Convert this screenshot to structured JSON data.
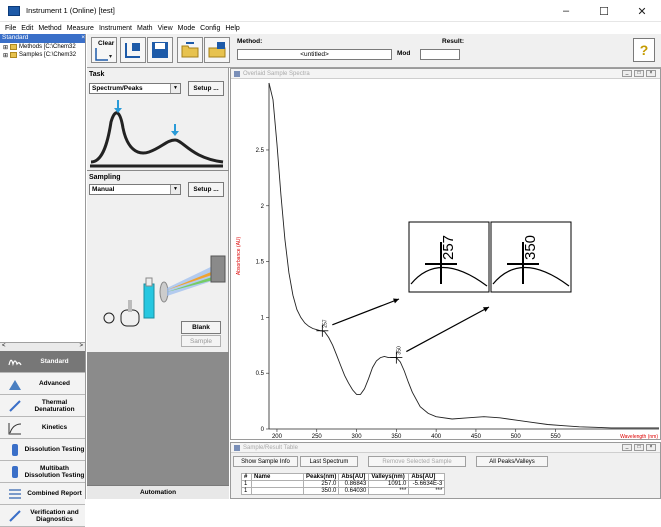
{
  "window": {
    "title": "Instrument 1 (Online) [test]",
    "controls": [
      "–",
      "☐",
      "✕"
    ]
  },
  "menu": [
    "File",
    "Edit",
    "Method",
    "Measure",
    "Instrument",
    "Math",
    "View",
    "Mode",
    "Config",
    "Help"
  ],
  "tree": {
    "header": "Standard",
    "items": [
      "Methods [C:\\Chem32",
      "Samples [C:\\Chem32"
    ]
  },
  "scroll": {
    "left": "<",
    "right": ">"
  },
  "nav": [
    {
      "label": "Standard",
      "icon": "standard-icon",
      "active": true
    },
    {
      "label": "Advanced",
      "icon": "advanced-icon"
    },
    {
      "label": "Thermal Denaturation",
      "icon": "thermal-icon"
    },
    {
      "label": "Kinetics",
      "icon": "kinetics-icon"
    },
    {
      "label": "Dissolution Testing",
      "icon": "dissolution-icon"
    },
    {
      "label": "Multibath Dissolution Testing",
      "icon": "multibath-icon"
    },
    {
      "label": "Combined Report",
      "icon": "report-icon"
    },
    {
      "label": "Verification and Diagnostics",
      "icon": "verification-icon"
    }
  ],
  "toolbar": {
    "clear_label": "Clear",
    "method_label": "Method:",
    "method_value": "<untitled>",
    "mod_label": "Mod",
    "result_label": "Result:",
    "help_glyph": "?"
  },
  "task": {
    "label": "Task",
    "selected": "Spectrum/Peaks",
    "setup_label": "Setup ...",
    "sampling_label": "Sampling",
    "sampling_selected": "Manual",
    "sampling_setup_label": "Setup ...",
    "blank_label": "Blank",
    "sample_label": "Sample"
  },
  "automation_label": "Automation",
  "spectra": {
    "window_title": "Overlaid Sample Spectra",
    "ylabel": "Absorbance (AU)",
    "xlabel": "Wavelength (nm)",
    "peak_labels": [
      "257",
      "350"
    ],
    "zoom_labels": [
      "257",
      "350"
    ]
  },
  "chart_data": {
    "type": "line",
    "title": "Overlaid Sample Spectra",
    "xlabel": "Wavelength (nm)",
    "ylabel": "Absorbance (AU)",
    "xlim": [
      190,
      680
    ],
    "ylim": [
      0,
      3.1
    ],
    "xticks": [
      "200",
      "250",
      "300",
      "350",
      "400",
      "450",
      "500",
      "550"
    ],
    "yticks": [
      "0",
      "0.5",
      "1",
      "1.5",
      "2",
      "2.5"
    ],
    "grid": false,
    "series": [
      {
        "x": [
          190,
          195,
          200,
          205,
          210,
          215,
          220,
          225,
          230,
          235,
          240,
          245,
          250,
          255,
          257,
          260,
          265,
          270,
          275,
          280,
          285,
          290,
          295,
          300,
          305,
          310,
          315,
          320,
          325,
          330,
          335,
          340,
          345,
          350,
          355,
          360,
          365,
          370,
          380,
          390,
          400,
          420,
          440,
          460,
          480,
          500,
          520,
          540,
          560,
          580,
          600,
          620,
          640,
          660,
          680
        ],
        "y": [
          3.1,
          2.95,
          2.55,
          2.1,
          1.7,
          1.4,
          1.2,
          1.07,
          1.0,
          0.95,
          0.92,
          0.9,
          0.89,
          0.88,
          0.88,
          0.87,
          0.82,
          0.75,
          0.66,
          0.57,
          0.48,
          0.41,
          0.35,
          0.31,
          0.31,
          0.36,
          0.45,
          0.55,
          0.61,
          0.64,
          0.65,
          0.64,
          0.64,
          0.64,
          0.6,
          0.52,
          0.42,
          0.33,
          0.2,
          0.14,
          0.11,
          0.09,
          0.1,
          0.11,
          0.1,
          0.08,
          0.06,
          0.04,
          0.03,
          0.02,
          0.015,
          0.01,
          0.01,
          0.01,
          0.01
        ]
      }
    ],
    "peaks": [
      {
        "x": 257,
        "y": 0.88
      },
      {
        "x": 350,
        "y": 0.64
      }
    ]
  },
  "result_table": {
    "window_title": "Sample/Result Table",
    "buttons": [
      {
        "label": "Show Sample Info",
        "disabled": false
      },
      {
        "label": "Last Spectrum",
        "disabled": false
      },
      {
        "label": "Remove Selected Sample",
        "disabled": true
      },
      {
        "label": "All Peaks/Valleys",
        "disabled": false
      }
    ],
    "columns": [
      "#",
      "Name",
      "Peaks(nm)",
      "Abs[AU]",
      "Valleys(nm)",
      "Abs[AU]"
    ],
    "rows": [
      [
        "1",
        "",
        "257.0",
        "0.86843",
        "1091.0",
        "-5.6634E-3"
      ],
      [
        "1",
        "",
        "350.0",
        "0.64030",
        "***",
        "***"
      ]
    ]
  }
}
